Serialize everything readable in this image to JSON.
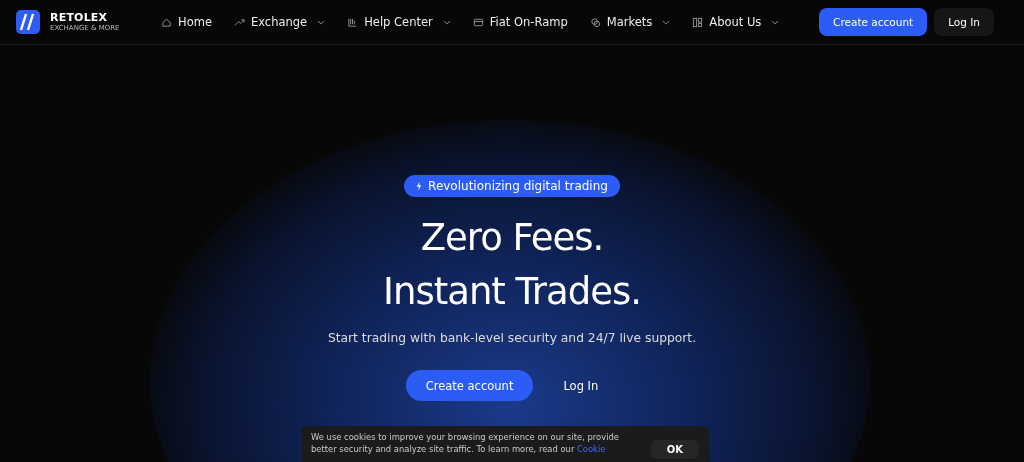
{
  "brand": {
    "name": "RETOLEX",
    "tagline": "EXCHANGE & MORE"
  },
  "nav": [
    {
      "label": "Home",
      "dropdown": false
    },
    {
      "label": "Exchange",
      "dropdown": true
    },
    {
      "label": "Help Center",
      "dropdown": true
    },
    {
      "label": "Fiat On-Ramp",
      "dropdown": false
    },
    {
      "label": "Markets",
      "dropdown": true
    },
    {
      "label": "About Us",
      "dropdown": true
    }
  ],
  "header_buttons": [
    {
      "label": "Create account",
      "kind": "primary"
    },
    {
      "label": "Log In",
      "kind": "secondary"
    }
  ],
  "hero": {
    "badge": "Revolutionizing digital trading",
    "title_lines": [
      "Zero Fees.",
      "Instant Trades."
    ],
    "subtitle": "Start trading with bank-level security and 24/7 live support.",
    "buttons": [
      {
        "label": "Create account",
        "kind": "primary"
      },
      {
        "label": "Log In",
        "kind": "plain"
      }
    ]
  },
  "cookie_banner": {
    "text": "We use cookies to improve your browsing experience on our site, provide better security and analyze site traffic. To learn more, read our",
    "link": "Cookie",
    "button": "OK"
  }
}
